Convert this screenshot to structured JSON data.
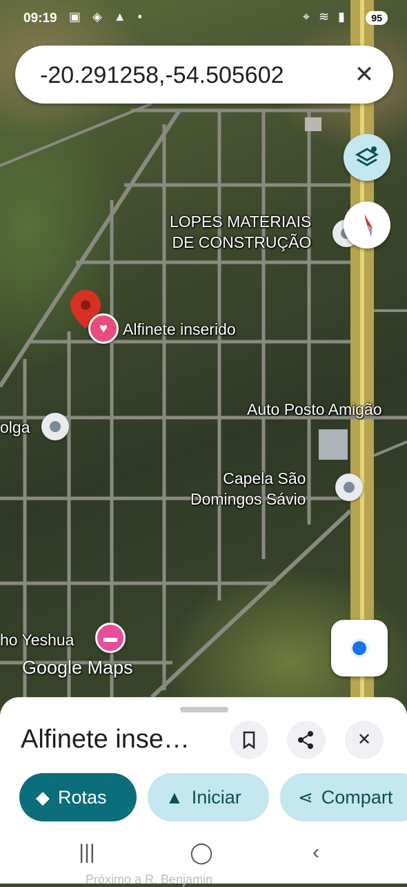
{
  "status_bar": {
    "time": "09:19",
    "left_icons": "▣ ◈ ▲ •",
    "right_icons": "⌖ ≋ ▮",
    "battery": "95"
  },
  "search": {
    "value": "-20.291258,-54.505602",
    "close_glyph": "✕"
  },
  "map": {
    "labels": {
      "lopes": "LOPES MATERIAIS\nDE CONSTRUÇÃO",
      "pin": "Alfinete inserido",
      "auto_posto": "Auto Posto Amigão",
      "olga": "olga",
      "capela": "Capela São\nDomingos Sávio",
      "yeshua": "ho Yeshua"
    },
    "logo": "Google Maps"
  },
  "sheet": {
    "title": "Alfinete inse…",
    "actions": {
      "save_glyph": "🔖",
      "share_glyph": "⋖",
      "close_glyph": "✕"
    },
    "chips": {
      "rotas": "Rotas",
      "iniciar": "Iniciar",
      "compartilhar": "Compart"
    },
    "subtext": "Próximo a R. Benjamin"
  },
  "nav": {
    "recent": "|||",
    "home": "◯",
    "back": "‹"
  },
  "colors": {
    "primary": "#0b6e7a",
    "chip_secondary": "#c4e7ef",
    "pin_red": "#d93025",
    "pin_pink": "#e84c7b"
  }
}
